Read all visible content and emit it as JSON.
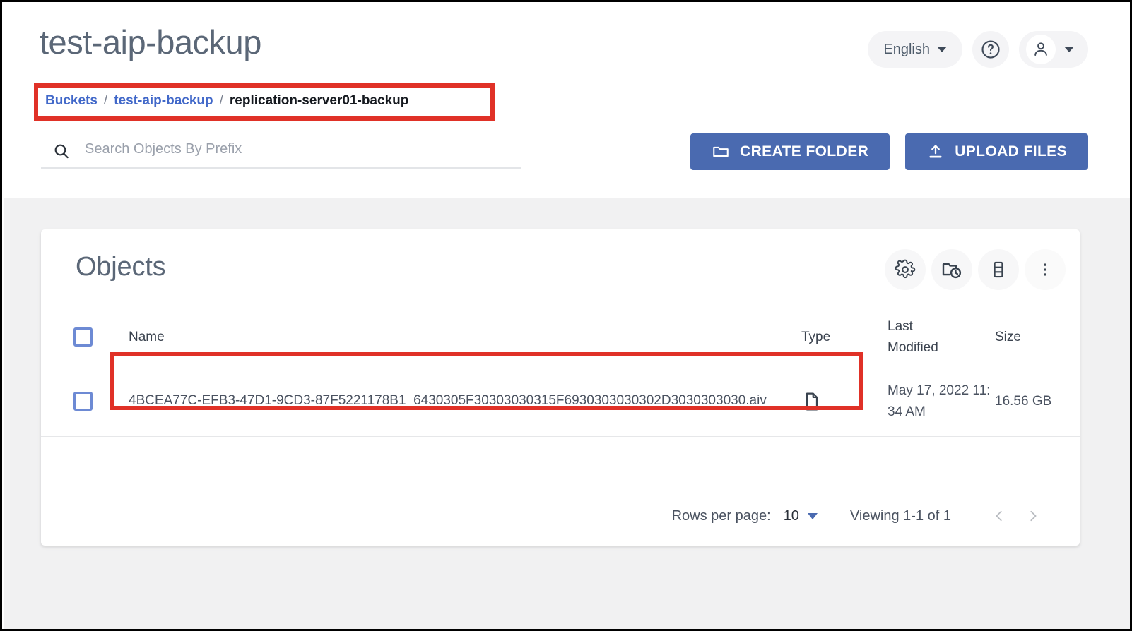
{
  "header": {
    "title": "test-aip-backup",
    "language_label": "English",
    "help_icon": "help-circle-icon",
    "user_icon": "person-icon"
  },
  "breadcrumb": {
    "root": "Buckets",
    "sep": "/",
    "bucket": "test-aip-backup",
    "current": "replication-server01-backup"
  },
  "search": {
    "placeholder": "Search Objects By Prefix",
    "value": "",
    "icon": "search-icon"
  },
  "toolbar": {
    "create_folder_label": "CREATE FOLDER",
    "create_folder_icon": "folder-icon",
    "upload_files_label": "UPLOAD FILES",
    "upload_files_icon": "upload-arrow-icon"
  },
  "objects_panel": {
    "title": "Objects",
    "icons": [
      {
        "name": "gear-icon",
        "title": "Settings"
      },
      {
        "name": "folder-clock-icon",
        "title": "Object Versions"
      },
      {
        "name": "storage-tier-icon",
        "title": "Rewind"
      },
      {
        "name": "more-vertical-icon",
        "title": "More options"
      }
    ],
    "columns": {
      "name": "Name",
      "type": "Type",
      "last_modified": "Last Modified",
      "last_modified_line1": "Last",
      "last_modified_line2": "Modified",
      "size": "Size"
    },
    "rows": [
      {
        "selected": false,
        "name": "4BCEA77C-EFB3-47D1-9CD3-87F5221178B1_6430305F30303030315F6930303030302D3030303030.aiv",
        "type_icon": "document-icon",
        "last_modified": "May 17, 2022 11:34 AM",
        "size": "16.56 GB"
      }
    ],
    "pagination": {
      "rows_per_page_label": "Rows per page:",
      "rows_per_page_value": "10",
      "viewing": "Viewing 1-1 of 1",
      "prev_icon": "chevron-left-icon",
      "next_icon": "chevron-right-icon"
    }
  },
  "colors": {
    "primary_button": "#4a6ab0",
    "link": "#4168c9",
    "highlight_box": "#e03127",
    "page_background": "#f1f1f2",
    "card_background": "#ffffff",
    "title_text": "#5b6777"
  }
}
